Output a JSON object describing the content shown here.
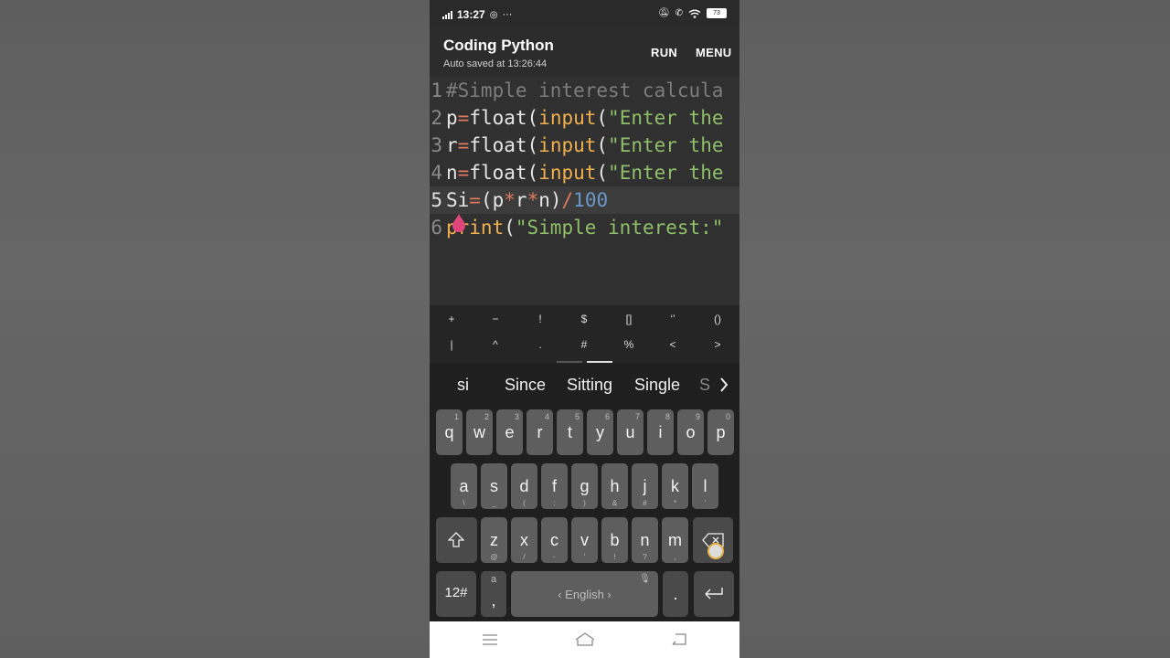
{
  "status": {
    "time": "13:27",
    "battery": "73"
  },
  "app": {
    "title": "Coding Python",
    "subtitle": "Auto saved at 13:26:44",
    "run_label": "RUN",
    "menu_label": "MENU"
  },
  "editor": {
    "lines": [
      {
        "num": "1",
        "parts": [
          {
            "t": "#Simple interest calcula",
            "c": "c-com"
          }
        ]
      },
      {
        "num": "2",
        "parts": [
          {
            "t": "p",
            "c": ""
          },
          {
            "t": "=",
            "c": "c-op"
          },
          {
            "t": "float(",
            "c": ""
          },
          {
            "t": "input",
            "c": "c-fn"
          },
          {
            "t": "(",
            "c": ""
          },
          {
            "t": "\"Enter the",
            "c": "c-str"
          }
        ]
      },
      {
        "num": "3",
        "parts": [
          {
            "t": "r",
            "c": ""
          },
          {
            "t": "=",
            "c": "c-op"
          },
          {
            "t": "float(",
            "c": ""
          },
          {
            "t": "input",
            "c": "c-fn"
          },
          {
            "t": "(",
            "c": ""
          },
          {
            "t": "\"Enter the",
            "c": "c-str"
          }
        ]
      },
      {
        "num": "4",
        "parts": [
          {
            "t": "n",
            "c": ""
          },
          {
            "t": "=",
            "c": "c-op"
          },
          {
            "t": "float(",
            "c": ""
          },
          {
            "t": "input",
            "c": "c-fn"
          },
          {
            "t": "(",
            "c": ""
          },
          {
            "t": "\"Enter the",
            "c": "c-str"
          }
        ]
      },
      {
        "num": "5",
        "parts": [
          {
            "t": "Si",
            "c": ""
          },
          {
            "t": "=",
            "c": "c-op"
          },
          {
            "t": "(p",
            "c": ""
          },
          {
            "t": "*",
            "c": "c-op"
          },
          {
            "t": "r",
            "c": ""
          },
          {
            "t": "*",
            "c": "c-op"
          },
          {
            "t": "n)",
            "c": ""
          },
          {
            "t": "/",
            "c": "c-op"
          },
          {
            "t": "100",
            "c": "c-num"
          }
        ]
      },
      {
        "num": "6",
        "parts": [
          {
            "t": "print",
            "c": "c-fn"
          },
          {
            "t": "(",
            "c": ""
          },
          {
            "t": "\"Simple interest:\"",
            "c": "c-str"
          }
        ]
      }
    ],
    "active_line": 5
  },
  "symbols": {
    "row1": [
      "+",
      "−",
      "!",
      "$",
      "[]",
      "‘’",
      "()"
    ],
    "row2": [
      "|",
      "^",
      ".",
      "#",
      "%",
      "<",
      ">"
    ]
  },
  "keyboard": {
    "suggestions": [
      "si",
      "Since",
      "Sitting",
      "Single",
      "S"
    ],
    "row1": [
      {
        "k": "q",
        "h": "1"
      },
      {
        "k": "w",
        "h": "2"
      },
      {
        "k": "e",
        "h": "3"
      },
      {
        "k": "r",
        "h": "4"
      },
      {
        "k": "t",
        "h": "5"
      },
      {
        "k": "y",
        "h": "6"
      },
      {
        "k": "u",
        "h": "7"
      },
      {
        "k": "i",
        "h": "8"
      },
      {
        "k": "o",
        "h": "9"
      },
      {
        "k": "p",
        "h": "0"
      }
    ],
    "row2": [
      {
        "k": "a",
        "b": "\\"
      },
      {
        "k": "s",
        "b": "_"
      },
      {
        "k": "d",
        "b": "("
      },
      {
        "k": "f",
        "b": ":"
      },
      {
        "k": "g",
        "b": ")"
      },
      {
        "k": "h",
        "b": "&"
      },
      {
        "k": "j",
        "b": "#"
      },
      {
        "k": "k",
        "b": "*"
      },
      {
        "k": "l",
        "b": "'"
      }
    ],
    "row3": [
      {
        "k": "z",
        "b": "@"
      },
      {
        "k": "x",
        "b": "/"
      },
      {
        "k": "c",
        "b": "-"
      },
      {
        "k": "v",
        "b": "'"
      },
      {
        "k": "b",
        "b": "!"
      },
      {
        "k": "n",
        "b": "?"
      },
      {
        "k": "m",
        "b": ","
      }
    ],
    "numkey": "12#",
    "comma": ",",
    "space": "English",
    "period": "."
  },
  "colors": {
    "accent_pin": "#e0457b"
  }
}
